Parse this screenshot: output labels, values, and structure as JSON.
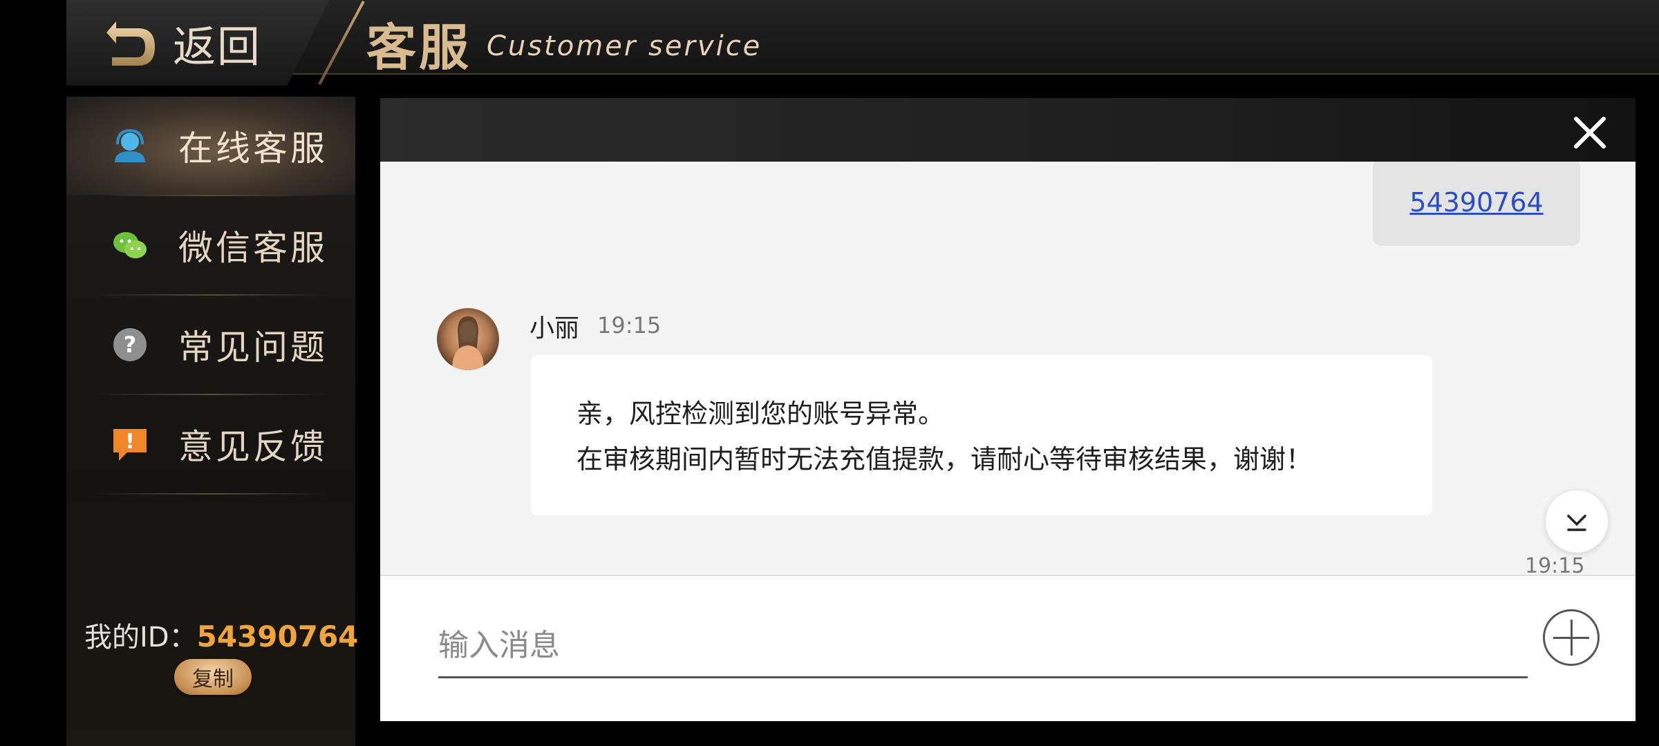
{
  "header": {
    "back_label": "返回",
    "title_cn": "客服",
    "title_en": "Customer service"
  },
  "sidebar": {
    "items": [
      {
        "label": "在线客服",
        "icon": "user-headset-icon",
        "active": true
      },
      {
        "label": "微信客服",
        "icon": "wechat-icon",
        "active": false
      },
      {
        "label": "常见问题",
        "icon": "question-icon",
        "active": false
      },
      {
        "label": "意见反馈",
        "icon": "feedback-icon",
        "active": false
      }
    ],
    "id_label": "我的ID：",
    "id_value": "54390764",
    "copy_label": "复制"
  },
  "chat": {
    "sent_message": "54390764",
    "agent_name": "小丽",
    "agent_time": "19:15",
    "agent_message_lines": [
      "亲，风控检测到您的账号异常。",
      "在审核期间内暂时无法充值提款，请耐心等待审核结果，谢谢！"
    ],
    "bottom_time": "19:15",
    "input_placeholder": "输入消息"
  },
  "colors": {
    "accent_gold": "#d8bb90",
    "id_orange": "#f0a43c",
    "link_blue": "#2c4ec4"
  }
}
